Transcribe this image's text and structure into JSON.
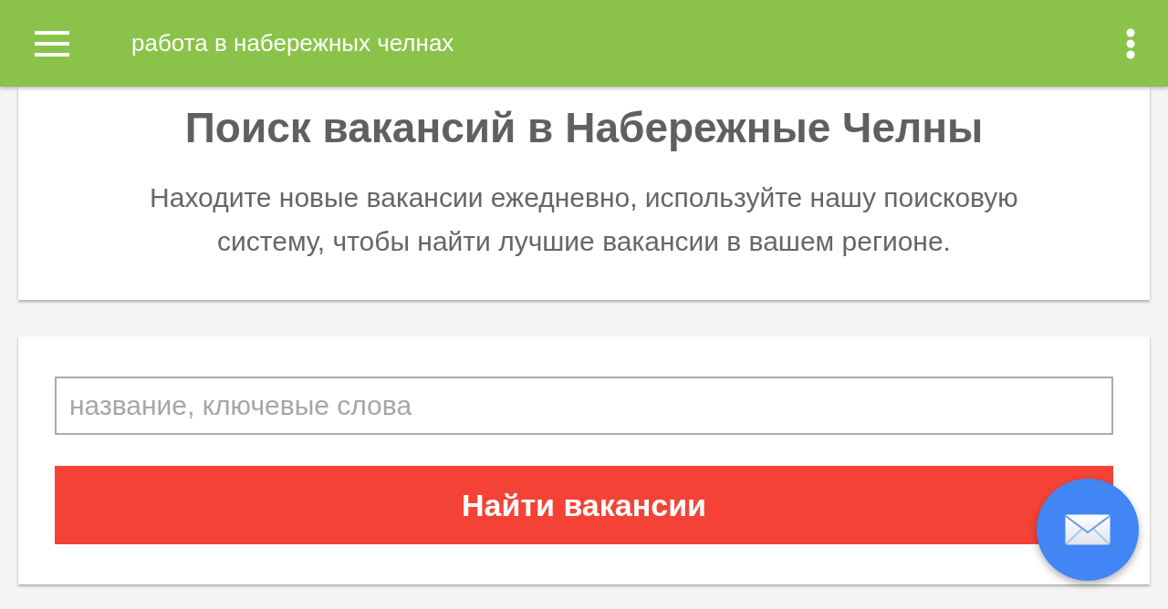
{
  "app_bar": {
    "title": "работа в набережных челнах"
  },
  "intro": {
    "heading": "Поиск вакансий в Набережные Челны",
    "text": "Находите новые вакансии ежедневно, используйте нашу поисковую систему, чтобы найти лучшие вакансии в вашем регионе."
  },
  "search": {
    "placeholder": "название, ключевые слова",
    "button": "Найти вакансии"
  }
}
